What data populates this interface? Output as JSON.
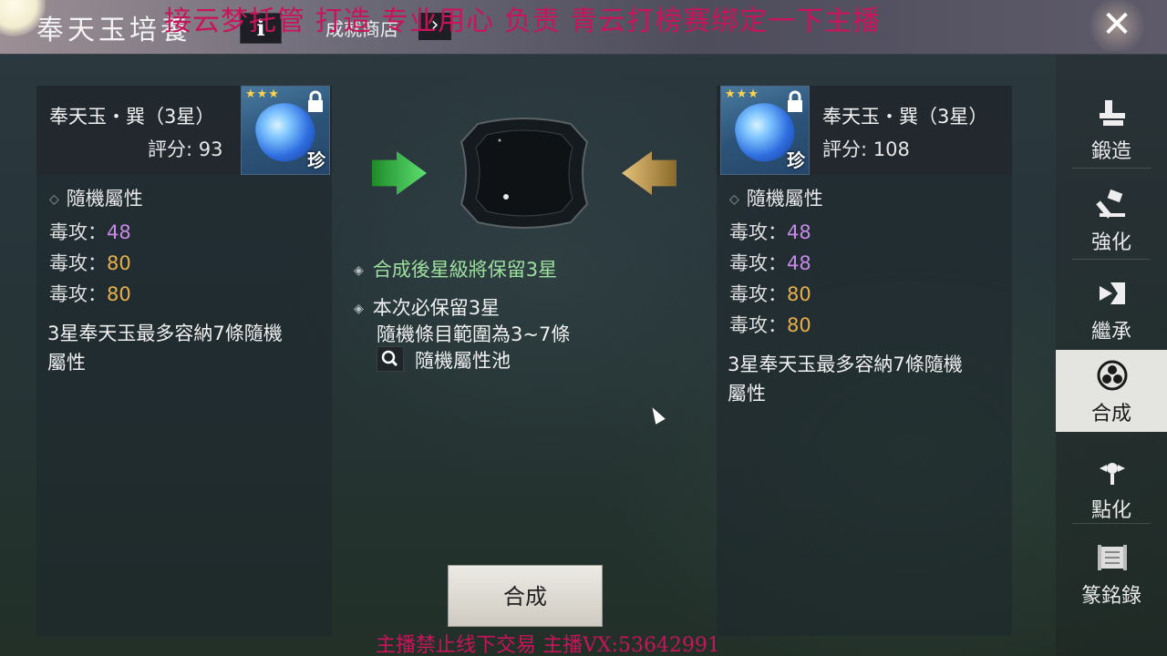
{
  "header": {
    "title": "奉天玉培養",
    "info_label": "i",
    "shop_label": "成就商店",
    "shop_arrow": "›",
    "close_label": "✕"
  },
  "overlays": {
    "top": "接云梦托管 打造 专业用心 负责   青云打榜赛绑定一下主播",
    "bottom": "主播禁止线下交易    主播VX:53642991"
  },
  "left_item": {
    "name": "奉天玉・巽（3星）",
    "score": "評分: 93",
    "stars": "★★★",
    "rarity": "珍",
    "section_title": "隨機屬性",
    "attributes": [
      {
        "label": "毒攻：",
        "value": "48",
        "color": "purple"
      },
      {
        "label": "毒攻：",
        "value": "80",
        "color": "gold"
      },
      {
        "label": "毒攻：",
        "value": "80",
        "color": "gold"
      }
    ],
    "note_line1": "3星奉天玉最多容納7條隨機",
    "note_line2": "屬性"
  },
  "right_item": {
    "name": "奉天玉・巽（3星）",
    "score": "評分: 108",
    "stars": "★★★",
    "rarity": "珍",
    "section_title": "隨機屬性",
    "attributes": [
      {
        "label": "毒攻：",
        "value": "48",
        "color": "purple"
      },
      {
        "label": "毒攻：",
        "value": "48",
        "color": "purple"
      },
      {
        "label": "毒攻：",
        "value": "80",
        "color": "gold"
      },
      {
        "label": "毒攻：",
        "value": "80",
        "color": "gold"
      }
    ],
    "note_line1": "3星奉天玉最多容納7條隨機",
    "note_line2": "屬性"
  },
  "center": {
    "line1": "合成後星級將保留3星",
    "line2": "本次必保留3星",
    "line3": "隨機條目範圍為3~7條",
    "pool_label": "隨機屬性池",
    "combine_button": "合成"
  },
  "nav": {
    "items": [
      {
        "label": "鍛造",
        "icon": "anvil-icon",
        "active": false
      },
      {
        "label": "強化",
        "icon": "hammer-icon",
        "active": false
      },
      {
        "label": "繼承",
        "icon": "inherit-icon",
        "active": false
      },
      {
        "label": "合成",
        "icon": "combine-icon",
        "active": true
      },
      {
        "label": "點化",
        "icon": "enlighten-icon",
        "active": false
      },
      {
        "label": "篆銘錄",
        "icon": "scroll-icon",
        "active": false
      }
    ]
  },
  "colors": {
    "purple": "#c48ae6",
    "gold": "#e8b04a",
    "green_text": "#9ee0a0",
    "overlay_red": "#c8145a"
  }
}
